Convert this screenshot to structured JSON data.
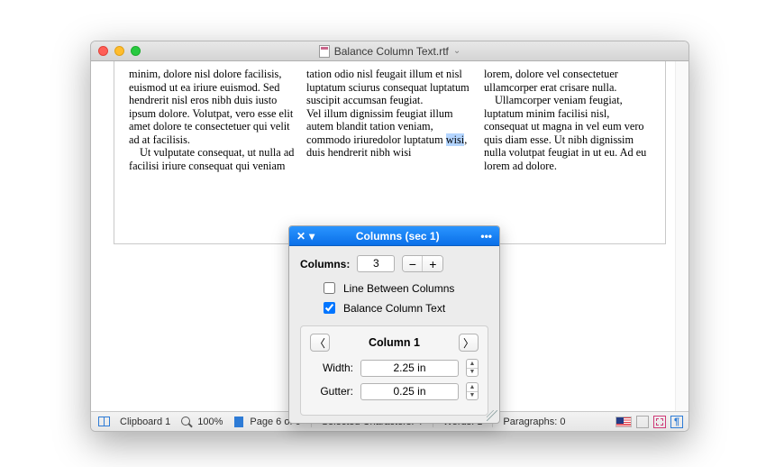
{
  "window": {
    "title": "Balance Column Text.rtf"
  },
  "document": {
    "col1": {
      "p1": "minim, dolore nisl dolore facilisis, euismod ut ea iriure euismod. Sed hendrerit nisl eros nibh duis iusto ipsum dolore. Volutpat, vero esse elit amet dolore te consectetuer qui velit ad at facilisis.",
      "p2": "Ut vulputate consequat, ut nulla ad facilisi iriure consequat qui veniam"
    },
    "col2": {
      "p1": "tation odio nisl feugait illum et nisl luptatum sciurus consequat luptatum suscipit accumsan feugiat.",
      "p2a": "Vel illum dignissim feugiat illum autem blandit tation veniam, commodo iriuredolor luptatum ",
      "p2_sel": "wisi",
      "p2b": ", duis hendrerit nibh wisi"
    },
    "col3": {
      "p1": "lorem, dolore vel consectetuer ullamcorper erat crisare nulla.",
      "p2": "Ullamcorper veniam feugiat, luptatum minim facilisi nisl, consequat ut magna in vel eum vero quis diam esse. Ut nibh dignissim nulla volutpat feugiat in ut eu. Ad eu lorem ad dolore."
    }
  },
  "palette": {
    "title": "Columns (sec 1)",
    "columns_label": "Columns:",
    "columns_value": "3",
    "check_line": "Line Between Columns",
    "check_balance": "Balance Column Text",
    "sub_title": "Column 1",
    "width_label": "Width:",
    "width_value": "2.25 in",
    "gutter_label": "Gutter:",
    "gutter_value": "0.25 in",
    "line_checked": false,
    "balance_checked": true
  },
  "status": {
    "clipboard": "Clipboard 1",
    "zoom": "100%",
    "page": "Page 6 of 6",
    "selchars": "Selected Characters: 4",
    "words": "Words: 1",
    "paragraphs": "Paragraphs: 0"
  }
}
